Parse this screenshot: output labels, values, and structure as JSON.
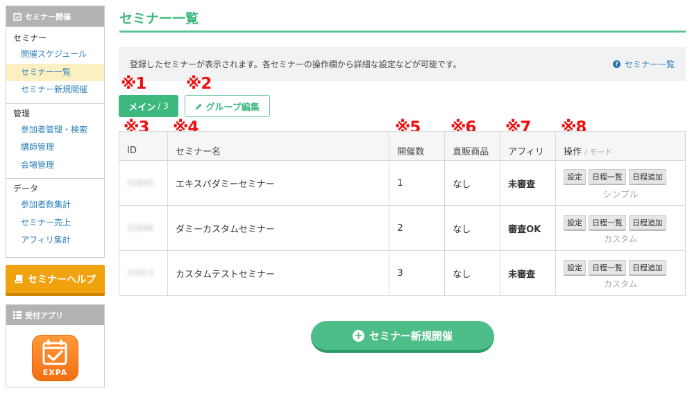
{
  "sidebar": {
    "seminar_header": "セミナー開催",
    "sections": [
      {
        "title": "セミナー",
        "links": [
          "開催スケジュール",
          "セミナー一覧",
          "セミナー新規開催"
        ]
      },
      {
        "title": "管理",
        "links": [
          "参加者管理・検索",
          "講師管理",
          "会場管理"
        ]
      },
      {
        "title": "データ",
        "links": [
          "参加者数集計",
          "セミナー売上",
          "アフィリ集計"
        ]
      }
    ],
    "help_button": "セミナーヘルプ",
    "app_header": "受付アプリ",
    "app_icon_text": "EXPA"
  },
  "page": {
    "title": "セミナー一覧",
    "info_text": "登録したセミナーが表示されます。各セミナーの操作欄から詳細な設定などが可能です。",
    "info_link": "セミナー一覧"
  },
  "annotations": [
    "※1",
    "※2",
    "※3",
    "※4",
    "※5",
    "※6",
    "※7",
    "※8"
  ],
  "tabs": {
    "main_label": "メイン",
    "main_count": "/ 3",
    "group_edit": "グループ編集"
  },
  "table": {
    "headers": {
      "id": "ID",
      "name": "セミナー名",
      "count": "開催数",
      "product": "直販商品",
      "affiliate": "アフィリ",
      "ops": "操作",
      "mode": "/ モード"
    },
    "op_buttons": [
      "設定",
      "日程一覧",
      "日程追加"
    ],
    "rows": [
      {
        "id": "32845",
        "name": "エキスパダミーセミナー",
        "count": "1",
        "product": "なし",
        "affiliate": "未審査",
        "aff_status": "pending",
        "mode": "シンプル"
      },
      {
        "id": "32846",
        "name": "ダミーカスタムセミナー",
        "count": "2",
        "product": "なし",
        "affiliate": "審査OK",
        "aff_status": "ok",
        "mode": "カスタム"
      },
      {
        "id": "33013",
        "name": "カスタムテストセミナー",
        "count": "3",
        "product": "なし",
        "affiliate": "未審査",
        "aff_status": "pending",
        "mode": "カスタム"
      }
    ]
  },
  "new_button": "セミナー新規開催",
  "colors": {
    "accent": "#3db87f",
    "link": "#2b7fb8",
    "warning": "#f0a20f",
    "annotation": "#ee1111"
  }
}
